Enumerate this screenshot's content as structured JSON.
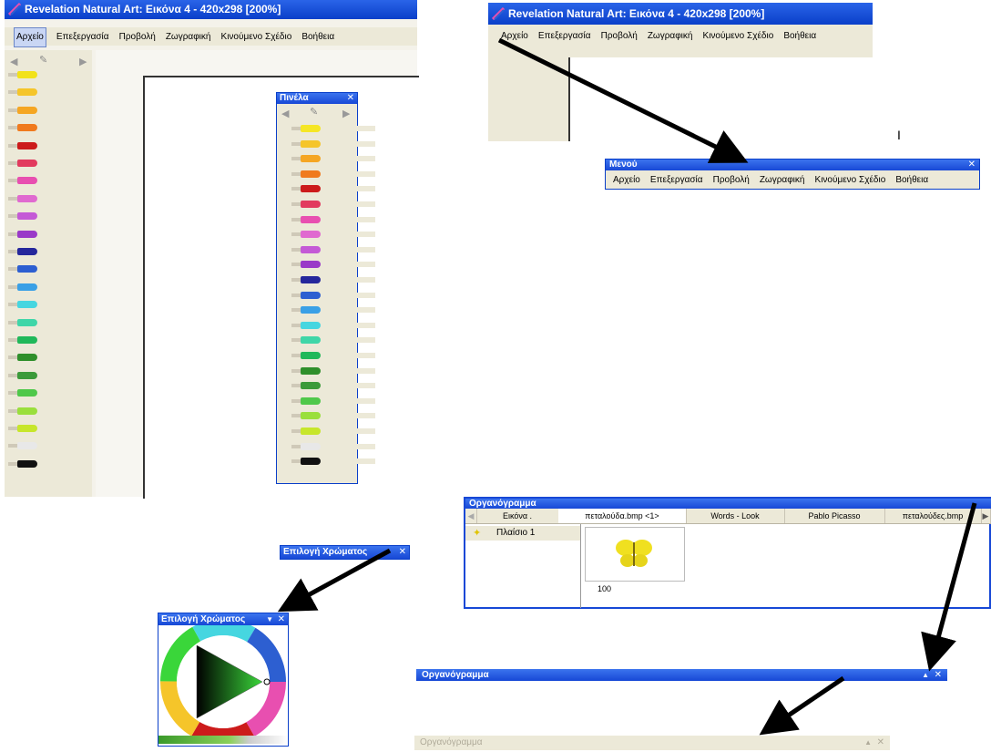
{
  "app_title": "Revelation Natural Art: Εικόνα 4 - 420x298 [200%]",
  "menu": [
    "Αρχείο",
    "Επεξεργασία",
    "Προβολή",
    "Ζωγραφική",
    "Κινούμενο Σχέδιο",
    "Βοήθεια"
  ],
  "menu_panel": {
    "title": "Μενού",
    "close": "✕",
    "items": [
      "Αρχείο",
      "Επεξεργασία",
      "Προβολή",
      "Ζωγραφική",
      "Κινούμενο Σχέδιο",
      "Βοήθεια"
    ]
  },
  "brush_panel": {
    "title": "Πινέλα",
    "close": "✕"
  },
  "pencil_colors": [
    "#f2e21a",
    "#f5c52a",
    "#f5a623",
    "#f07a1e",
    "#cc1b1b",
    "#e23a5e",
    "#e84fb0",
    "#e06ad0",
    "#c45ad6",
    "#9a39c8",
    "#25279c",
    "#2d5fd1",
    "#3aa0e6",
    "#46d6e0",
    "#3fd6a8",
    "#20b85a",
    "#2f8f2b",
    "#3b9a3a",
    "#4fc84a",
    "#9adf3c",
    "#c7e62b",
    "#e8e8e8",
    "#111111"
  ],
  "panel_pencil_colors": [
    "#f5e625",
    "#f5c52a",
    "#f5a623",
    "#f07a1e",
    "#cc1b1b",
    "#e23a5e",
    "#e84fb0",
    "#e06ad0",
    "#c45ad6",
    "#9a39c8",
    "#25279c",
    "#2d5fd1",
    "#3aa0e6",
    "#46d6e0",
    "#3fd6a8",
    "#20b85a",
    "#2f8f2b",
    "#3b9a3a",
    "#4fc84a",
    "#9adf3c",
    "#c7e62b",
    "#e8e8e8",
    "#111111"
  ],
  "color_picker": {
    "title": "Επιλογή Χρώματος",
    "dropdown": "▼",
    "close": "✕"
  },
  "storyboard": {
    "title": "Οργανόγραμμα",
    "tabs": [
      "Εικόνα .",
      "πεταλούδα.bmp <1>",
      "Words - Look",
      "Pablo Picasso",
      "πεταλούδες.bmp"
    ],
    "layer_label": "Πλαίσιο 1",
    "frame_caption": "100",
    "collapse_icon": "▲",
    "close": "✕"
  },
  "cursor_text": "I"
}
